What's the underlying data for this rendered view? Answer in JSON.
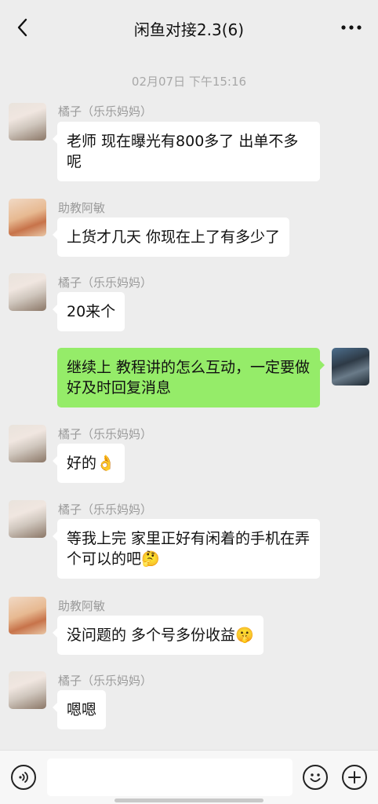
{
  "header": {
    "title": "闲鱼对接2.3(6)",
    "back_icon": "chevron-left-icon",
    "more_icon": "more-horizontal-icon"
  },
  "chat": {
    "timestamp": "02月07日 下午15:16",
    "messages": [
      {
        "sender": "橘子（乐乐妈妈）",
        "text": "老师 现在曝光有800多了 出单不多呢",
        "side": "left"
      },
      {
        "sender": "助教阿敏",
        "text": "上货才几天 你现在上了有多少了",
        "side": "left"
      },
      {
        "sender": "橘子（乐乐妈妈）",
        "text": "20来个",
        "side": "left"
      },
      {
        "sender": "",
        "text": "继续上 教程讲的怎么互动，一定要做好及时回复消息",
        "side": "right"
      },
      {
        "sender": "橘子（乐乐妈妈）",
        "text": "好的👌",
        "side": "left"
      },
      {
        "sender": "橘子（乐乐妈妈）",
        "text": "等我上完 家里正好有闲着的手机在弄个可以的吧🤔",
        "side": "left"
      },
      {
        "sender": "助教阿敏",
        "text": "没问题的 多个号多份收益🤫",
        "side": "left"
      },
      {
        "sender": "橘子（乐乐妈妈）",
        "text": "嗯嗯",
        "side": "left"
      }
    ]
  },
  "input_bar": {
    "placeholder": "",
    "voice_icon": "voice-icon",
    "emoji_icon": "emoji-icon",
    "plus_icon": "plus-icon"
  },
  "colors": {
    "background": "#ededed",
    "bubble_self": "#95ec69",
    "bubble_other": "#ffffff"
  }
}
